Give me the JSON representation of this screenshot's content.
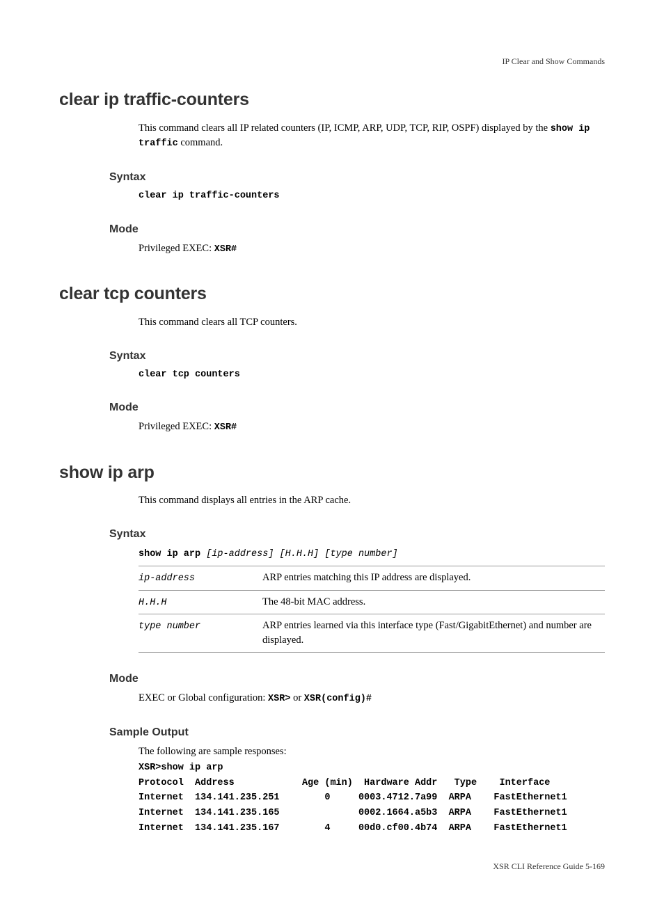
{
  "header": "IP Clear and Show Commands",
  "footer": "XSR CLI Reference Guide   5-169",
  "commands": [
    {
      "title": "clear ip traffic-counters",
      "desc_pre": "This command clears all IP related counters (IP, ICMP, ARP, UDP, TCP, RIP, OSPF) displayed by the ",
      "desc_code": "show ip traffic",
      "desc_post": " command.",
      "syntax_label": "Syntax",
      "syntax_code": "clear ip traffic-counters",
      "mode_label": "Mode",
      "mode_pre": "Privileged EXEC: ",
      "mode_code": "XSR#"
    },
    {
      "title": "clear tcp counters",
      "desc": "This command clears all TCP counters.",
      "syntax_label": "Syntax",
      "syntax_code": "clear tcp counters",
      "mode_label": "Mode",
      "mode_pre": "Privileged EXEC: ",
      "mode_code": "XSR#"
    }
  ],
  "show_ip_arp": {
    "title": "show ip arp",
    "desc": "This command displays all entries in the ARP cache.",
    "syntax_label": "Syntax",
    "syntax_cmd": "show ip arp ",
    "syntax_args": "[ip-address] [H.H.H] [type number]",
    "params": [
      {
        "name": "ip-address",
        "desc": "ARP entries matching this IP address are displayed."
      },
      {
        "name": "H.H.H",
        "desc": "The 48-bit MAC address."
      },
      {
        "name": "type number",
        "desc": "ARP entries learned via this interface type (Fast/GigabitEthernet) and number are displayed."
      }
    ],
    "mode_label": "Mode",
    "mode_pre": "EXEC or Global configuration: ",
    "mode_code1": "XSR>",
    "mode_mid": "  or  ",
    "mode_code2": "XSR(config)#",
    "sample_label": "Sample Output",
    "sample_intro": "The following are sample responses:",
    "sample_output": "XSR>show ip arp\nProtocol  Address            Age (min)  Hardware Addr   Type    Interface\nInternet  134.141.235.251        0     0003.4712.7a99  ARPA    FastEthernet1\nInternet  134.141.235.165              0002.1664.a5b3  ARPA    FastEthernet1\nInternet  134.141.235.167        4     00d0.cf00.4b74  ARPA    FastEthernet1"
  }
}
